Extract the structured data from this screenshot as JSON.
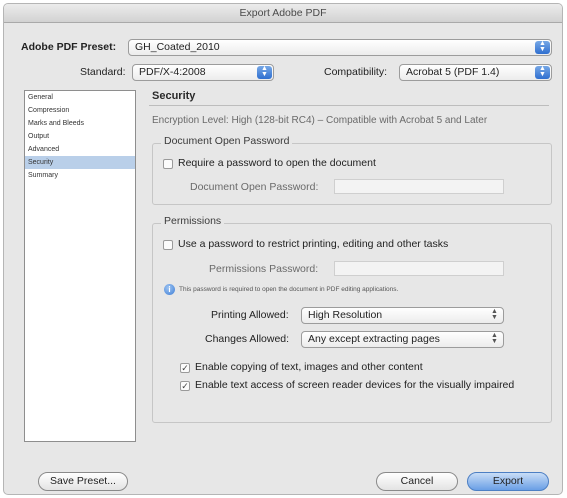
{
  "window": {
    "title": "Export Adobe PDF"
  },
  "preset": {
    "label": "Adobe PDF Preset:",
    "value": "GH_Coated_2010"
  },
  "standard": {
    "label": "Standard:",
    "value": "PDF/X-4:2008"
  },
  "compatibility": {
    "label": "Compatibility:",
    "value": "Acrobat 5 (PDF 1.4)"
  },
  "sidebar": {
    "items": [
      {
        "label": "General",
        "selected": false
      },
      {
        "label": "Compression",
        "selected": false
      },
      {
        "label": "Marks and Bleeds",
        "selected": false
      },
      {
        "label": "Output",
        "selected": false
      },
      {
        "label": "Advanced",
        "selected": false
      },
      {
        "label": "Security",
        "selected": true
      },
      {
        "label": "Summary",
        "selected": false
      }
    ]
  },
  "security": {
    "title": "Security",
    "encryption": "Encryption Level: High (128-bit RC4) – Compatible with Acrobat 5 and Later",
    "open_password": {
      "legend": "Document Open Password",
      "require_label": "Require a password to open the document",
      "require_checked": false,
      "field_label": "Document Open Password:",
      "field_value": ""
    },
    "permissions": {
      "legend": "Permissions",
      "use_password_label": "Use a password to restrict printing, editing and other tasks",
      "use_password_checked": false,
      "field_label": "Permissions Password:",
      "field_value": "",
      "note": "This password is required to open the document in PDF editing applications.",
      "printing_label": "Printing Allowed:",
      "printing_value": "High Resolution",
      "changes_label": "Changes Allowed:",
      "changes_value": "Any except extracting pages",
      "copy_label": "Enable copying of text, images and other content",
      "copy_checked": true,
      "access_label": "Enable text access of screen reader devices for the visually impaired",
      "access_checked": true
    }
  },
  "buttons": {
    "save_preset": "Save Preset...",
    "cancel": "Cancel",
    "export": "Export"
  }
}
